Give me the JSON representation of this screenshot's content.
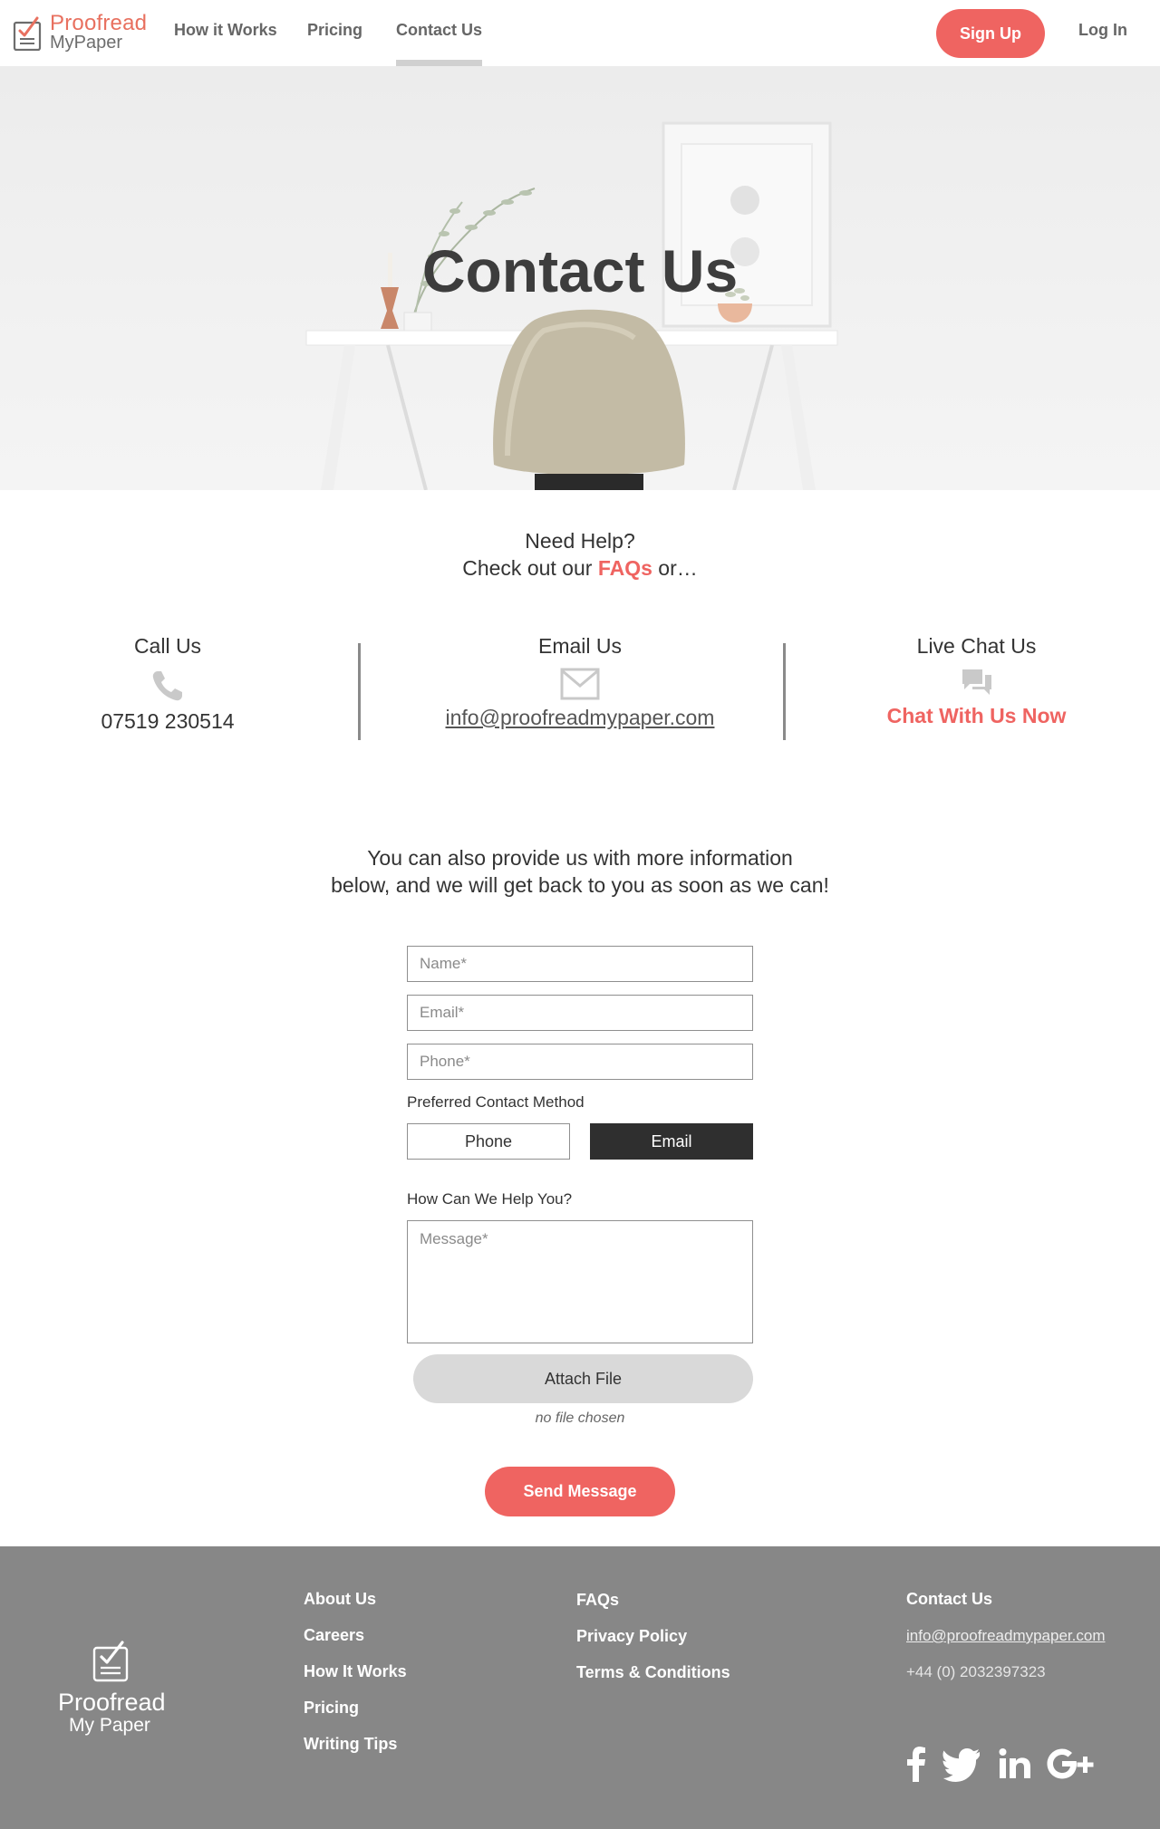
{
  "nav": {
    "logo_top": "Proofread",
    "logo_bottom": "MyPaper",
    "links": [
      "How it Works",
      "Pricing",
      "Contact Us"
    ],
    "active": "Contact Us",
    "signup_label": "Sign Up",
    "login_label": "Log In"
  },
  "hero": {
    "title": "Contact Us"
  },
  "help": {
    "line1": "Need Help?",
    "line2_prefix": "Check out our",
    "faq_label": "FAQs",
    "line2_suffix": "or…"
  },
  "contact": {
    "call": {
      "title": "Call Us",
      "value": "07519 230514",
      "icon": "phone-icon"
    },
    "email": {
      "title": "Email Us",
      "value": "info@proofreadmypaper.com",
      "icon": "envelope-icon"
    },
    "chat": {
      "title": "Live Chat Us",
      "value": "Chat With Us Now",
      "icon": "chat-bubbles-icon"
    }
  },
  "more_info": {
    "line1": "You can also provide us with more information",
    "line2": "below, and we will get back to you as soon as we can!"
  },
  "form": {
    "name_placeholder": "Name*",
    "email_placeholder": "Email*",
    "phone_placeholder": "Phone*",
    "method_label": "Preferred Contact Method",
    "method_phone": "Phone",
    "method_email": "Email",
    "method_selected": "Email",
    "help_label": "How Can We Help You?",
    "message_placeholder": "Message*",
    "attach_label": "Attach File",
    "no_file": "no file chosen",
    "send_label": "Send Message"
  },
  "footer": {
    "logo_top": "Proofread",
    "logo_bottom": "My Paper",
    "col1": [
      "About Us",
      "Careers",
      "How It Works",
      "Pricing",
      "Writing Tips"
    ],
    "col2": [
      "FAQs",
      "Privacy Policy",
      "Terms & Conditions"
    ],
    "contact_title": "Contact Us",
    "contact_email": "info@proofreadmypaper.com",
    "contact_phone": "+44 (0) 2032397323",
    "social": [
      "facebook-icon",
      "twitter-icon",
      "linkedin-icon",
      "google-plus-icon"
    ]
  },
  "colors": {
    "accent": "#ef6461",
    "dark": "#2f2f2f",
    "footer_bg": "#878787"
  }
}
